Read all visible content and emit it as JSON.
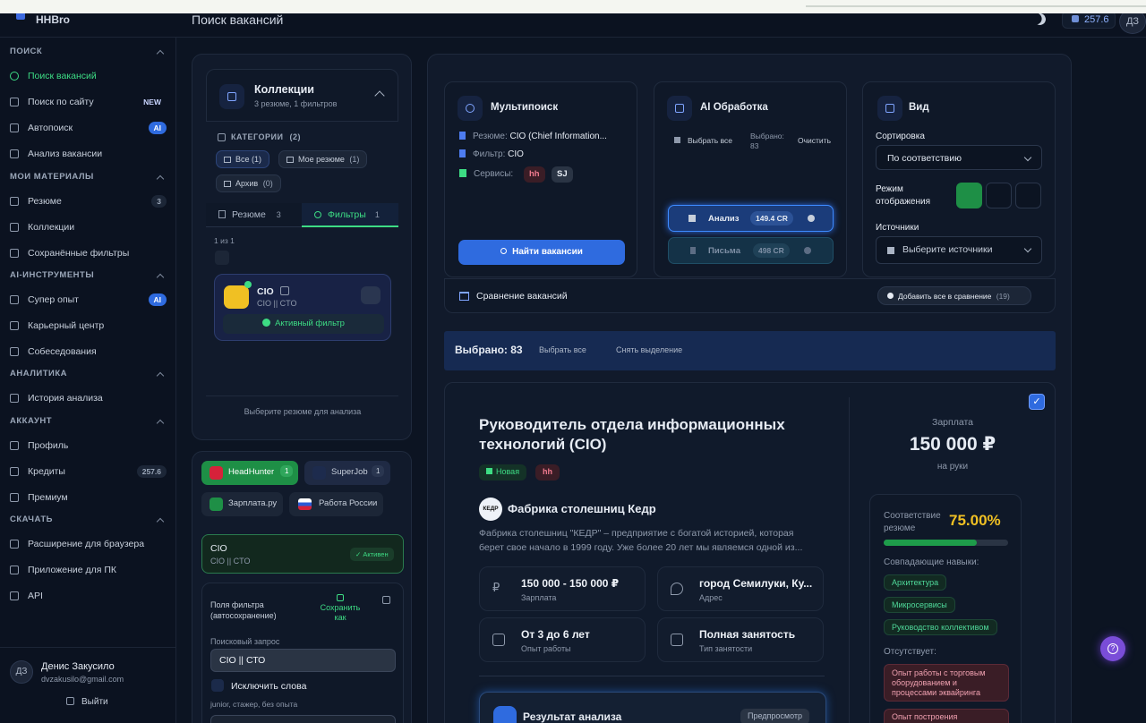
{
  "header": {
    "brand": "HHBro",
    "page_title": "Поиск вакансий",
    "credits": "257.6",
    "user_initials": "ДЗ"
  },
  "sidebar": {
    "sections": [
      {
        "title": "ПОИСК",
        "items": [
          {
            "label": "Поиск вакансий",
            "icon": "search-icon",
            "active": true
          },
          {
            "label": "Поиск по сайту",
            "icon": "search-icon",
            "badge": "NEW"
          },
          {
            "label": "Автопоиск",
            "icon": "robot-icon",
            "badge": "AI"
          },
          {
            "label": "Анализ вакансии",
            "icon": "chart-icon"
          }
        ]
      },
      {
        "title": "МОИ МАТЕРИАЛЫ",
        "items": [
          {
            "label": "Резюме",
            "icon": "document-icon",
            "badge": "3"
          },
          {
            "label": "Коллекции",
            "icon": "folder-icon"
          },
          {
            "label": "Сохранённые фильтры",
            "icon": "filter-icon"
          }
        ]
      },
      {
        "title": "AI-ИНСТРУМЕНТЫ",
        "items": [
          {
            "label": "Супер опыт",
            "icon": "star-icon",
            "badge": "AI"
          },
          {
            "label": "Карьерный центр",
            "icon": "briefcase-icon"
          },
          {
            "label": "Собеседования",
            "icon": "chat-icon"
          }
        ]
      },
      {
        "title": "АНАЛИТИКА",
        "items": [
          {
            "label": "История анализа",
            "icon": "history-icon"
          }
        ]
      },
      {
        "title": "АККАУНТ",
        "items": [
          {
            "label": "Профиль",
            "icon": "user-icon"
          },
          {
            "label": "Кредиты",
            "icon": "coin-icon",
            "badge": "257.6"
          },
          {
            "label": "Премиум",
            "icon": "crown-icon"
          }
        ]
      },
      {
        "title": "СКАЧАТЬ",
        "items": [
          {
            "label": "Расширение для браузера",
            "icon": "puzzle-icon"
          },
          {
            "label": "Приложение для ПК",
            "icon": "monitor-icon"
          },
          {
            "label": "API",
            "icon": "code-icon"
          }
        ]
      }
    ],
    "user": {
      "initials": "ДЗ",
      "name": "Денис Закусило",
      "email": "dvzakusilo@gmail.com",
      "logout": "Выйти"
    }
  },
  "collections": {
    "title": "Коллекции",
    "subtitle": "3 резюме, 1 фильтров",
    "categories_label": "КАТЕГОРИИ",
    "categories_count": "(2)",
    "chips": [
      {
        "label": "Все",
        "count": "(1)"
      },
      {
        "label": "Мое резюме",
        "count": "(1)"
      },
      {
        "label": "Архив",
        "count": "(0)"
      }
    ],
    "tab_resume": "Резюме",
    "tab_resume_count": "3",
    "tab_filters": "Фильтры",
    "tab_filters_count": "1",
    "pager": "1 из 1",
    "filter_card": {
      "title": "CIO",
      "subtitle": "CIO || CTO",
      "status": "Активный фильтр"
    },
    "footer": "Выберите резюме для анализа"
  },
  "sources_panel": {
    "sources": [
      {
        "label": "HeadHunter",
        "count": "1"
      },
      {
        "label": "SuperJob",
        "count": "1"
      },
      {
        "label": "Зарплата.ру"
      },
      {
        "label": "Работа России"
      }
    ],
    "active_filter": {
      "title": "CIO",
      "subtitle": "CIO || CTO",
      "status": "Активен"
    },
    "fields_title": "Поля фильтра (автосохранение)",
    "save_as": "Сохранить как",
    "query_label": "Поисковый запрос",
    "query_value": "CIO || СТО",
    "exclude_label": "Исключить слова",
    "exclude_hint": "junior, стажер, без опыта"
  },
  "multisearch": {
    "title": "Мультипоиск",
    "resume_label": "Резюме:",
    "resume_value": "CIO (Chief Information...",
    "filter_label": "Фильтр:",
    "filter_value": "CIO",
    "services_label": "Сервисы:",
    "services": [
      "hh",
      "SJ"
    ],
    "button": "Найти вакансии"
  },
  "ai": {
    "title": "AI Обработка",
    "select_all": "Выбрать все",
    "selected_label": "Выбрано:",
    "selected_value": "83",
    "clear": "Очистить",
    "analysis_label": "Анализ",
    "analysis_cost": "149.4 CR",
    "letters_label": "Письма",
    "letters_cost": "498 CR"
  },
  "view": {
    "title": "Вид",
    "sort_label": "Сортировка",
    "sort_value": "По соответствию",
    "mode_label": "Режим отображения",
    "sources_label": "Источники",
    "sources_placeholder": "Выберите источники"
  },
  "compare": {
    "label": "Сравнение вакансий",
    "add_all": "Добавить все в сравнение",
    "count": "(19)"
  },
  "selection": {
    "selected": "Выбрано: 83",
    "select_all": "Выбрать все",
    "deselect": "Снять выделение"
  },
  "vacancy": {
    "title": "Руководитель отдела информационных технологий (CIO)",
    "tag_new": "Новая",
    "tag_source": "hh",
    "company_logo": "КЕДР",
    "company": "Фабрика столешниц Кедр",
    "description": "Фабрика столешниц \"КЕДР\" – предприятие с богатой историей, которая берет свое начало в 1999 году. Уже более 20 лет мы являемся одной из...",
    "facts": [
      {
        "value": "150 000 - 150 000 ₽",
        "label": "Зарплата",
        "icon": "ruble-icon"
      },
      {
        "value": "город Семилуки, Ку...",
        "label": "Адрес",
        "icon": "location-icon"
      },
      {
        "value": "От 3 до 6 лет",
        "label": "Опыт работы",
        "icon": "briefcase-icon"
      },
      {
        "value": "Полная занятость",
        "label": "Тип занятости",
        "icon": "document-icon"
      }
    ],
    "salary_label": "Зарплата",
    "salary_value": "150 000 ₽",
    "salary_note": "на руки",
    "match_label": "Соответствие резюме",
    "match_value": "75.00%",
    "match_fraction": 0.75,
    "skills_label": "Совпадающие навыки:",
    "skills": [
      "Архитектура",
      "Микросервисы",
      "Руководство коллективом"
    ],
    "missing_label": "Отсутствует:",
    "missing": [
      "Опыт работы с торговым оборудованием и процессами эквайринга",
      "Опыт построения"
    ],
    "analysis_title": "Результат анализа",
    "preview": "Предпросмотр"
  }
}
